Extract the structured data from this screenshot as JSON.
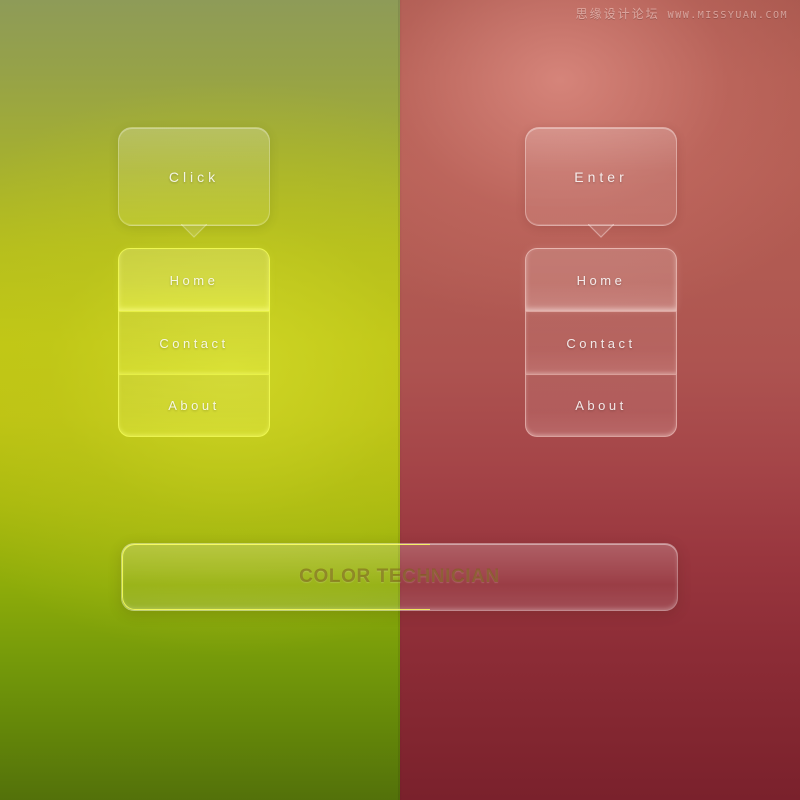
{
  "watermark": {
    "site_name": "思缘设计论坛",
    "url": "WWW.MISSYUAN.COM"
  },
  "colors": {
    "green_top": "#8e9b58",
    "green_mid": "#c2c713",
    "green_bottom": "#53710a",
    "green_neon_edge": "#faff5a",
    "red_top": "#a7564c",
    "red_mid": "#b35c52",
    "red_bottom": "#7a212c",
    "label_white": "#ffffff",
    "bar_label": "#785f14"
  },
  "panels": [
    {
      "id": "green",
      "tooltip_label": "Click",
      "menu": [
        {
          "label": "Home",
          "state": "active"
        },
        {
          "label": "Contact",
          "state": "normal"
        },
        {
          "label": "About",
          "state": "normal"
        }
      ]
    },
    {
      "id": "red",
      "tooltip_label": "Enter",
      "menu": [
        {
          "label": "Home",
          "state": "active"
        },
        {
          "label": "Contact",
          "state": "normal"
        },
        {
          "label": "About",
          "state": "normal"
        }
      ]
    }
  ],
  "bottom_bar": {
    "label": "COLOR TECHNICIAN"
  }
}
